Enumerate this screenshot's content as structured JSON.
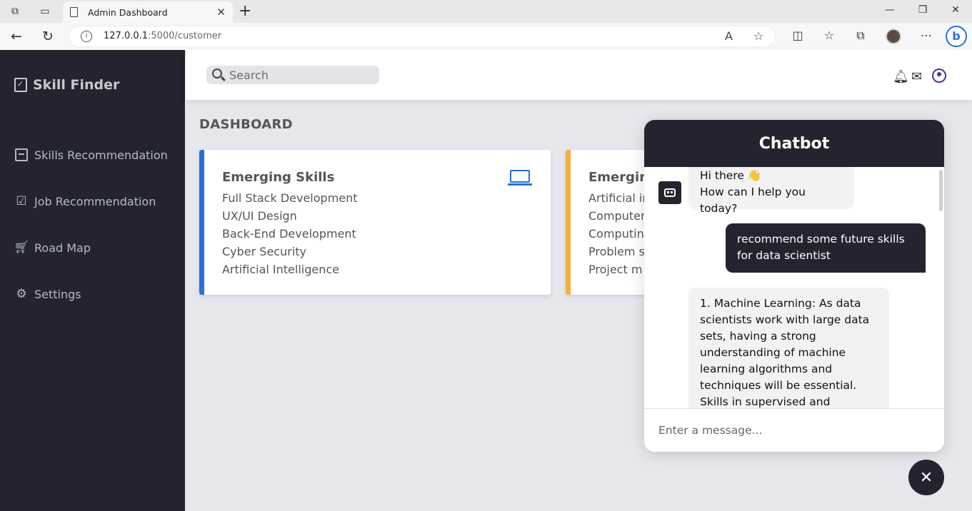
{
  "browser": {
    "tab_title": "Admin Dashboard",
    "url_host": "127.0.0.1",
    "url_path": ":5000/customer",
    "new_tab": "+",
    "tab_close": "✕"
  },
  "sidebar": {
    "brand": "Skill Finder",
    "items": [
      {
        "label": "Skills Recommendation",
        "icon": "archive-icon"
      },
      {
        "label": "Job Recommendation",
        "icon": "checklist-icon"
      },
      {
        "label": "Road Map",
        "icon": "cart-icon"
      },
      {
        "label": "Settings",
        "icon": "gear-icon"
      }
    ]
  },
  "header": {
    "search_placeholder": "Search"
  },
  "main": {
    "title": "DASHBOARD",
    "cards": [
      {
        "title": "Emerging Skills",
        "accent": "#2a6fdb",
        "items": [
          "Full Stack Development",
          "UX/UI Design",
          "Back-End Development",
          "Cyber Security",
          "Artificial Intelligence"
        ]
      },
      {
        "title": "Emerging",
        "accent": "#f0b23a",
        "items": [
          "Artificial in",
          "Computer",
          "Computin",
          "Problem s",
          "Project m"
        ]
      }
    ]
  },
  "chatbot": {
    "title": "Chatbot",
    "messages": [
      {
        "from": "bot",
        "lines": [
          "Hi there 👋",
          "How can I help you today?"
        ]
      },
      {
        "from": "user",
        "lines": [
          "recommend  some future skills",
          "for data scientist"
        ]
      },
      {
        "from": "bot",
        "lines": [
          "1. Machine Learning: As data",
          "scientists work with large data",
          "sets, having a strong",
          "understanding of machine",
          "learning algorithms and",
          "techniques will be essential.",
          "Skills in supervised and"
        ]
      }
    ],
    "input_placeholder": "Enter a message...",
    "close_symbol": "✕"
  }
}
